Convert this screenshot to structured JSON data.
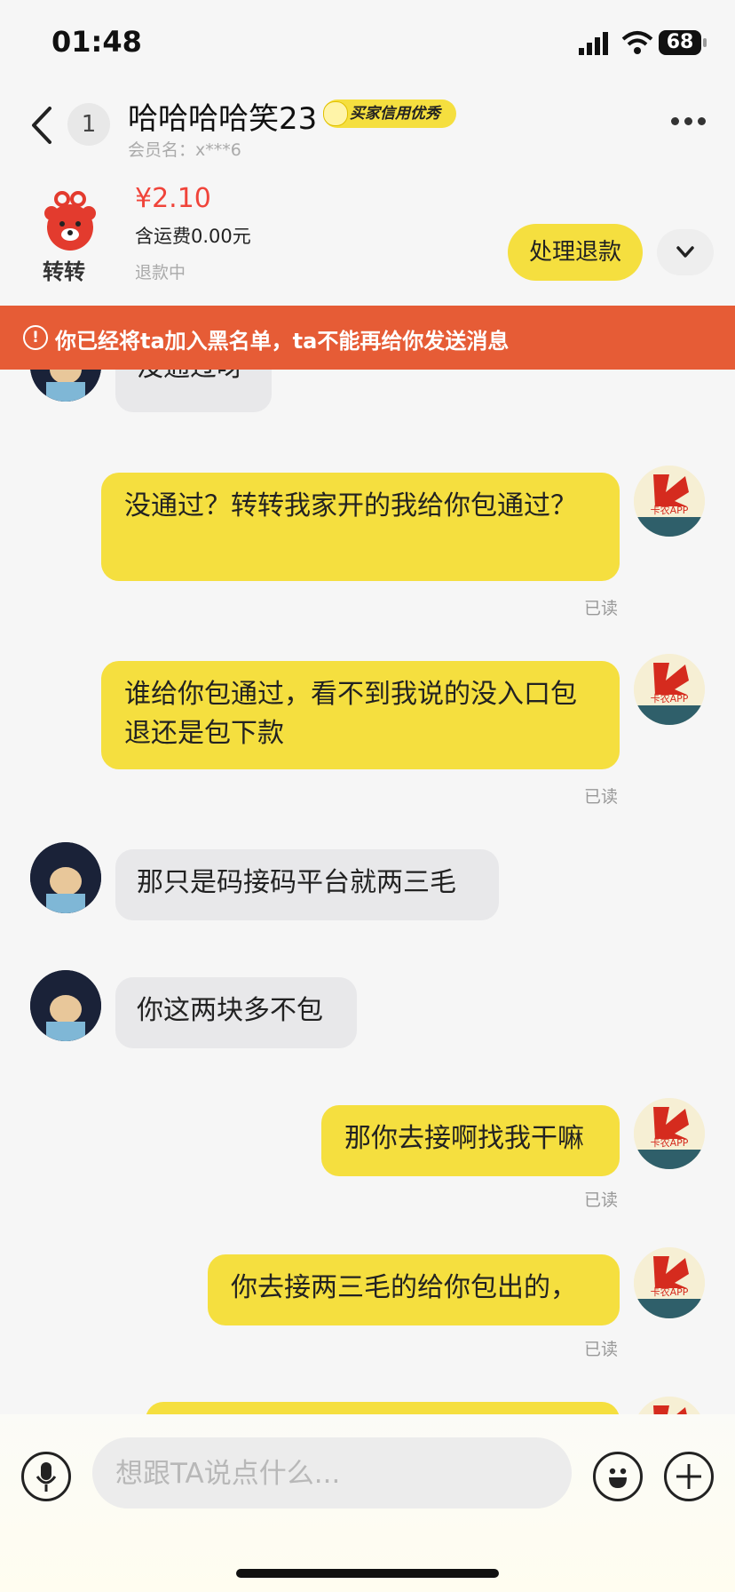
{
  "status_bar": {
    "time": "01:48",
    "battery": "68"
  },
  "header": {
    "unread_count": "1",
    "title": "哈哈哈哈笑23",
    "credit_badge": "买家信用优秀",
    "member_name": "会员名：x***6"
  },
  "order": {
    "app_name": "转转",
    "price": "¥2.10",
    "shipping": "含运费0.00元",
    "status": "退款中",
    "refund_button": "处理退款"
  },
  "banner": {
    "text": "你已经将ta加入黑名单，ta不能再给你发送消息"
  },
  "messages": [
    {
      "side": "left",
      "text": "没通过呀"
    },
    {
      "side": "right",
      "text": "没通过？转转我家开的我给你包通过？",
      "status": "已读"
    },
    {
      "side": "right",
      "text": "谁给你包通过，看不到我说的没入口包退还是包下款",
      "status": "已读"
    },
    {
      "side": "left",
      "text": "那只是码接码平台就两三毛"
    },
    {
      "side": "left",
      "text": "你这两块多不包"
    },
    {
      "side": "right",
      "text": "那你去接啊找我干嘛",
      "status": "已读"
    },
    {
      "side": "right",
      "text": "你去接两三毛的给你包出的，",
      "status": "已读"
    }
  ],
  "my_avatar_label": "卡农APP",
  "input": {
    "placeholder": "想跟TA说点什么..."
  },
  "icons": [
    "back-icon",
    "more-icon",
    "mic-icon",
    "emoji-icon",
    "plus-icon",
    "chevron-down-icon",
    "warning-icon"
  ],
  "colors": {
    "accent_yellow": "#f5df3f",
    "banner_orange": "#e65c36",
    "price_red": "#f0443a"
  }
}
